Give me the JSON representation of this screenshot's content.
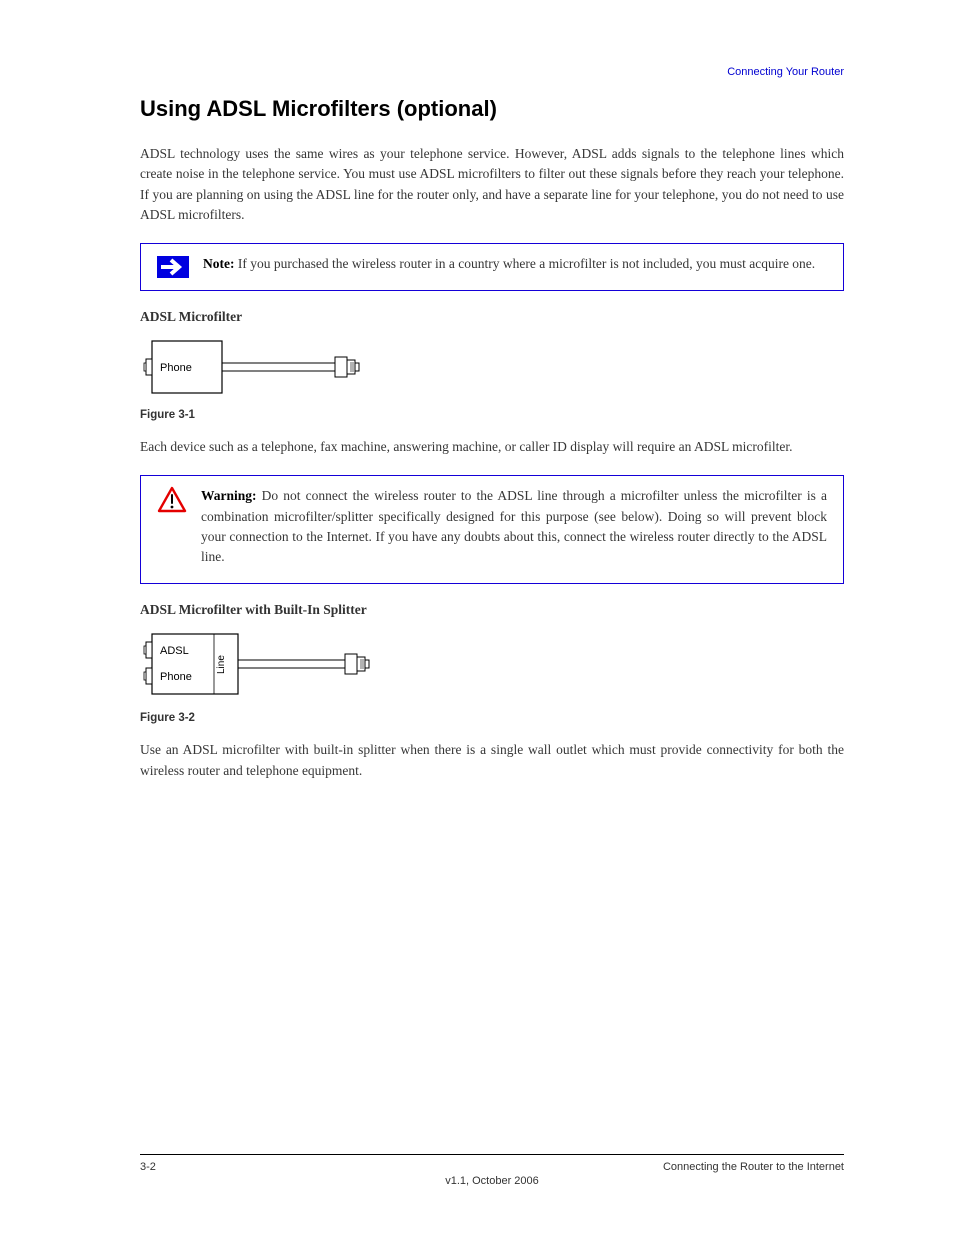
{
  "crumb": "Connecting Your Router",
  "title": "Using ADSL Microfilters (optional)",
  "para1": "ADSL technology uses the same wires as your telephone service. However, ADSL adds signals to the telephone lines which create noise in the telephone service. You must use ADSL microfilters to filter out these signals before they reach your telephone. If you are planning on using the ADSL line for the router only, and have a separate line for your telephone, you do not need to use ADSL microfilters.",
  "note": {
    "label": "Note:",
    "text": "If you purchased the wireless router in a country where a microfilter is not included, you must acquire one."
  },
  "subhead1": "ADSL Microfilter",
  "fig1_caption": "Figure 3-1",
  "para2": "Each device such as a telephone, fax machine, answering machine, or caller ID display will require an ADSL microfilter.",
  "warn": {
    "label": "Warning:",
    "text": "Do not connect the wireless router to the ADSL line through a microfilter unless the microfilter is a combination microfilter/splitter specifically designed for this purpose (see below). Doing so will prevent block your connection to the Internet. If you have any doubts about this, connect the wireless router directly to the ADSL line."
  },
  "subhead2": "ADSL Microfilter with Built-In Splitter",
  "fig2_caption": "Figure 3-2",
  "para3": "Use an ADSL microfilter with built-in splitter when there is a single wall outlet which must provide connectivity for both the wireless router and telephone equipment.",
  "fig1_labels": {
    "phone": "Phone"
  },
  "fig2_labels": {
    "adsl": "ADSL",
    "phone": "Phone",
    "line": "Line"
  },
  "footer": {
    "left": "3-2",
    "ver_top": "v1.1, October 2006",
    "right": "Connecting the Router to the Internet"
  }
}
